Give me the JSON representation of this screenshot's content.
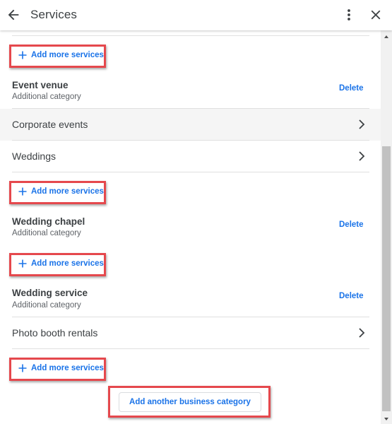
{
  "header": {
    "title": "Services",
    "back_icon": "arrow-left-icon",
    "menu_icon": "more-vert-icon",
    "close_icon": "close-icon"
  },
  "colors": {
    "accent": "#1a73e8",
    "highlight_box": "#e5484d",
    "text_primary": "#3c4043",
    "text_secondary": "#5f6368",
    "divider": "#e0e0e0",
    "row_hover": "#f5f5f5"
  },
  "add_services_label": "Add more services",
  "categories": [
    {
      "name": "Event venue",
      "type": "Additional category",
      "delete_label": "Delete",
      "services": [
        "Corporate events",
        "Weddings"
      ]
    },
    {
      "name": "Wedding chapel",
      "type": "Additional category",
      "delete_label": "Delete",
      "services": []
    },
    {
      "name": "Wedding service",
      "type": "Additional category",
      "delete_label": "Delete",
      "services": [
        "Photo booth rentals"
      ]
    }
  ],
  "add_category_label": "Add another business category"
}
